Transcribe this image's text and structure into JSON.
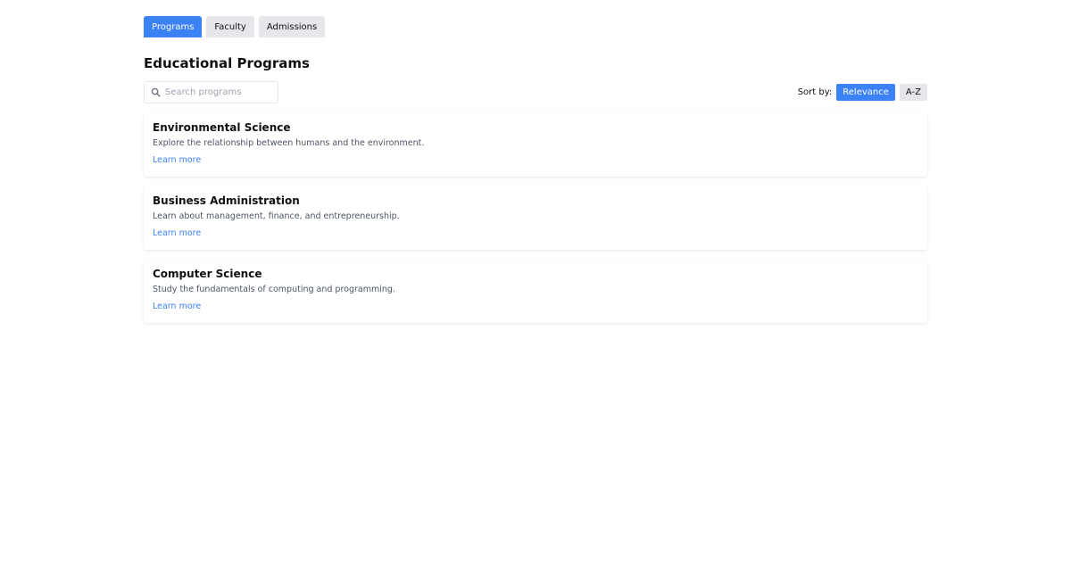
{
  "tabs": [
    {
      "label": "Programs",
      "active": true
    },
    {
      "label": "Faculty",
      "active": false
    },
    {
      "label": "Admissions",
      "active": false
    }
  ],
  "page_title": "Educational Programs",
  "search": {
    "placeholder": "Search programs",
    "value": ""
  },
  "sort": {
    "label": "Sort by:",
    "options": [
      {
        "label": "Relevance",
        "active": true
      },
      {
        "label": "A-Z",
        "active": false
      }
    ]
  },
  "programs": [
    {
      "title": "Environmental Science",
      "description": "Explore the relationship between humans and the environment.",
      "link": "Learn more"
    },
    {
      "title": "Business Administration",
      "description": "Learn about management, finance, and entrepreneurship.",
      "link": "Learn more"
    },
    {
      "title": "Computer Science",
      "description": "Study the fundamentals of computing and programming.",
      "link": "Learn more"
    }
  ],
  "colors": {
    "accent": "#3b82f6",
    "tab_inactive": "#e5e7eb",
    "muted_text": "#4b5563"
  },
  "icons": {
    "search": "search-icon"
  }
}
